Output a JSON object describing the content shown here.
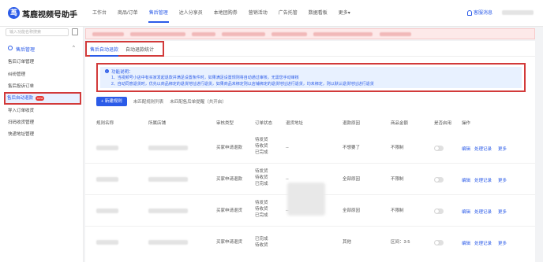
{
  "app": {
    "title": "茑鹿视频号助手",
    "logo_letter": "茑"
  },
  "nav": [
    "工作台",
    "商品/订单",
    "售后管理",
    "达人分享员",
    "本地团购券",
    "营销活动",
    "广告托管",
    "数据看板",
    "更多▾"
  ],
  "nav_active_index": 2,
  "header": {
    "messages_label": "客服消息"
  },
  "sidebar": {
    "search_placeholder": "输入功能名称搜索",
    "section_label": "售后管理",
    "items": [
      "售后订单管理",
      "纠纷管理",
      "售后投诉订单",
      "售后自动退款",
      "导入订单收货",
      "扫码收货管理",
      "快递地址管理"
    ],
    "active_index": 3,
    "new_badge": "new"
  },
  "tabs": [
    "售后自动退款",
    "自动退款统计"
  ],
  "tabs_active_index": 0,
  "notice": {
    "title": "功能说明：",
    "line1": "1、当视频号小店中有买家发起退款并满足设置条件时，如果满足设置规则将自动通过审核，无需您手动审核",
    "line2": "2、自动同意退货时，优先以商品绑定的退货地址进行退货，如果商品未绑定则以店铺绑定的退货地址进行退货，均未绑定，则以默认退货地址进行退货"
  },
  "actions": {
    "new_rule": "+ 新建规则",
    "configured": "未匹配规则列表",
    "unconfigured": "未匹配售后单提醒（共开启）"
  },
  "table": {
    "headers": [
      "规则名称",
      "所属店铺",
      "审核类型",
      "订单状态",
      "退货地址",
      "退款原因",
      "商品金额",
      "是否启用",
      "操作"
    ],
    "rows": [
      {
        "type": "买家申请退款",
        "status": [
          "待发货",
          "待收货",
          "已完成"
        ],
        "address": "--",
        "reason": "不想要了",
        "amount": "不限制"
      },
      {
        "type": "买家申请退款",
        "status": [
          "待发货",
          "待收货",
          "已完成"
        ],
        "address": "--",
        "reason": "全部原因",
        "amount": "不限制"
      },
      {
        "type": "买家申请退货",
        "status": [
          "待发货",
          "待收货",
          "已完成"
        ],
        "address": "--",
        "reason": "全部原因",
        "amount": "不限制"
      },
      {
        "type": "买家申请退货",
        "status": [
          "已完成",
          "待收货"
        ],
        "address": "",
        "reason": "其他",
        "amount": "区间：3-5"
      }
    ],
    "ops": [
      "编辑",
      "处理记录",
      "更多"
    ]
  },
  "colors": {
    "primary": "#2b5be8",
    "highlight": "#d23a3a",
    "notice_bg": "#e8f1ff"
  }
}
